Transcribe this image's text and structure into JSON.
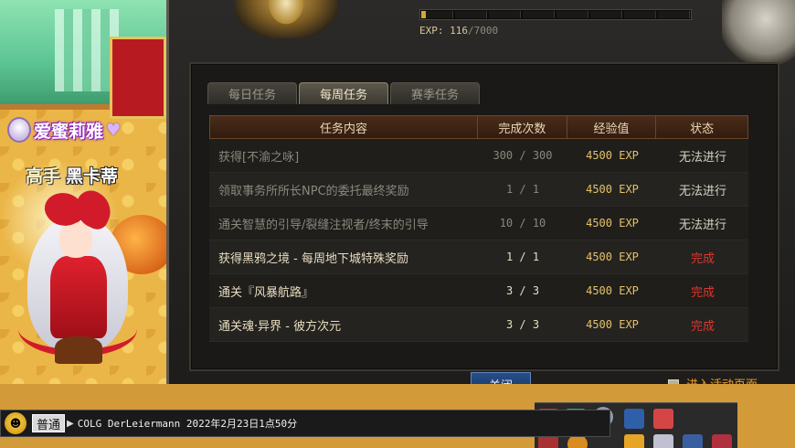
{
  "player": {
    "guild_name": "爱蜜莉雅",
    "rank": "高手",
    "nickname": "黑卡蒂"
  },
  "exp": {
    "label": "EXP:",
    "current": "116",
    "max": "/7000",
    "progress": 0.017
  },
  "tabs": [
    {
      "label": "每日任务",
      "active": false
    },
    {
      "label": "每周任务",
      "active": true
    },
    {
      "label": "赛季任务",
      "active": false
    }
  ],
  "table": {
    "headers": [
      "任务内容",
      "完成次数",
      "经验值",
      "状态"
    ],
    "rows": [
      {
        "task": "获得[不渝之咏]",
        "count": "300 / 300",
        "exp": "4500 EXP",
        "status": "无法进行",
        "state": "blocked"
      },
      {
        "task": "领取事务所所长NPC的委托最终奖励",
        "count": "1 / 1",
        "exp": "4500 EXP",
        "status": "无法进行",
        "state": "blocked"
      },
      {
        "task": "通关智慧的引导/裂缝注视者/终末的引导",
        "count": "10 / 10",
        "exp": "4500 EXP",
        "status": "无法进行",
        "state": "blocked"
      },
      {
        "task": "获得黑鸦之境 - 每周地下城特殊奖励",
        "count": "1 / 1",
        "exp": "4500 EXP",
        "status": "完成",
        "state": "done"
      },
      {
        "task": "通关『风暴航路』",
        "count": "3 / 3",
        "exp": "4500 EXP",
        "status": "完成",
        "state": "done"
      },
      {
        "task": "通关魂·异界 - 彼方次元",
        "count": "3 / 3",
        "exp": "4500 EXP",
        "status": "完成",
        "state": "done"
      }
    ]
  },
  "buttons": {
    "close": "关闭",
    "enter_event": "进入活动页面"
  },
  "chat": {
    "channel": "普通",
    "message": "COLG DerLeiermann 2022年2月23日1点50分"
  },
  "colors": {
    "done": "#e0352b",
    "exp_fill": "#d4a736",
    "panel_bg": "#1a1917"
  }
}
